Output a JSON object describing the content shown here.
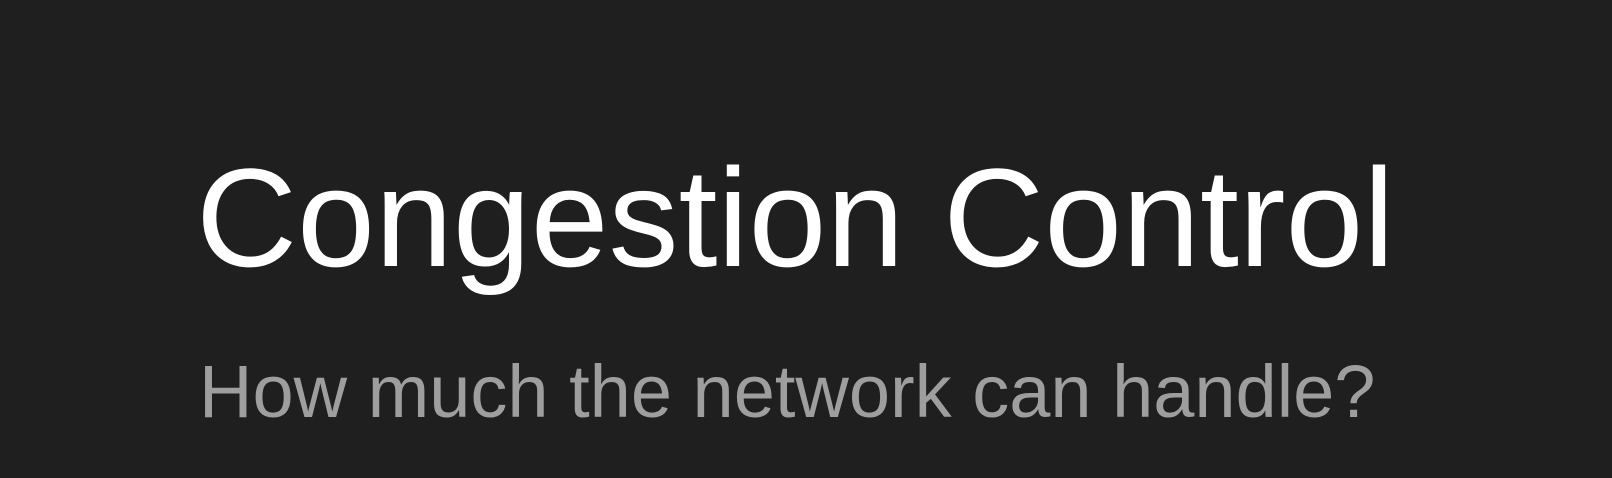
{
  "slide": {
    "title": "Congestion Control",
    "subtitle": "How much the network can handle?"
  },
  "colors": {
    "background": "#1f1f1f",
    "title": "#ffffff",
    "subtitle": "#9e9e9e"
  }
}
